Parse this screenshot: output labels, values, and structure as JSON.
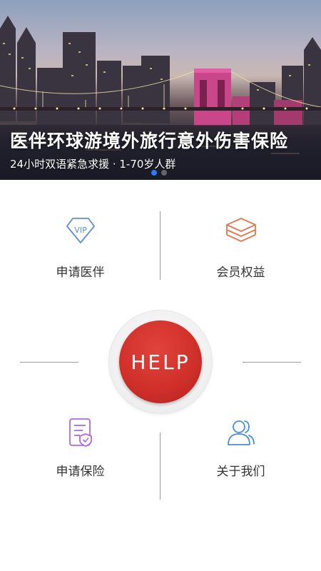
{
  "banner": {
    "title": "医伴环球游境外旅行意外伤害保险",
    "subtitle": "24小时双语紧急求援 · 1-70岁人群",
    "dots_total": 2,
    "active_dot": 1
  },
  "menu": {
    "apply_companion": {
      "label": "申请医伴",
      "icon": "vip-diamond-icon"
    },
    "member_benefits": {
      "label": "会员权益",
      "icon": "layers-icon"
    },
    "apply_insurance": {
      "label": "申请保险",
      "icon": "insurance-document-icon"
    },
    "about_us": {
      "label": "关于我们",
      "icon": "users-icon"
    }
  },
  "help_button": {
    "label": "HELP"
  },
  "colors": {
    "help_red": "#d1302a",
    "vip_blue": "#5b8fd6",
    "layers_orange": "#e07a4e",
    "document_purple": "#b268e0",
    "users_blue": "#4a8fdc",
    "dot_active": "#2e7bf0"
  }
}
